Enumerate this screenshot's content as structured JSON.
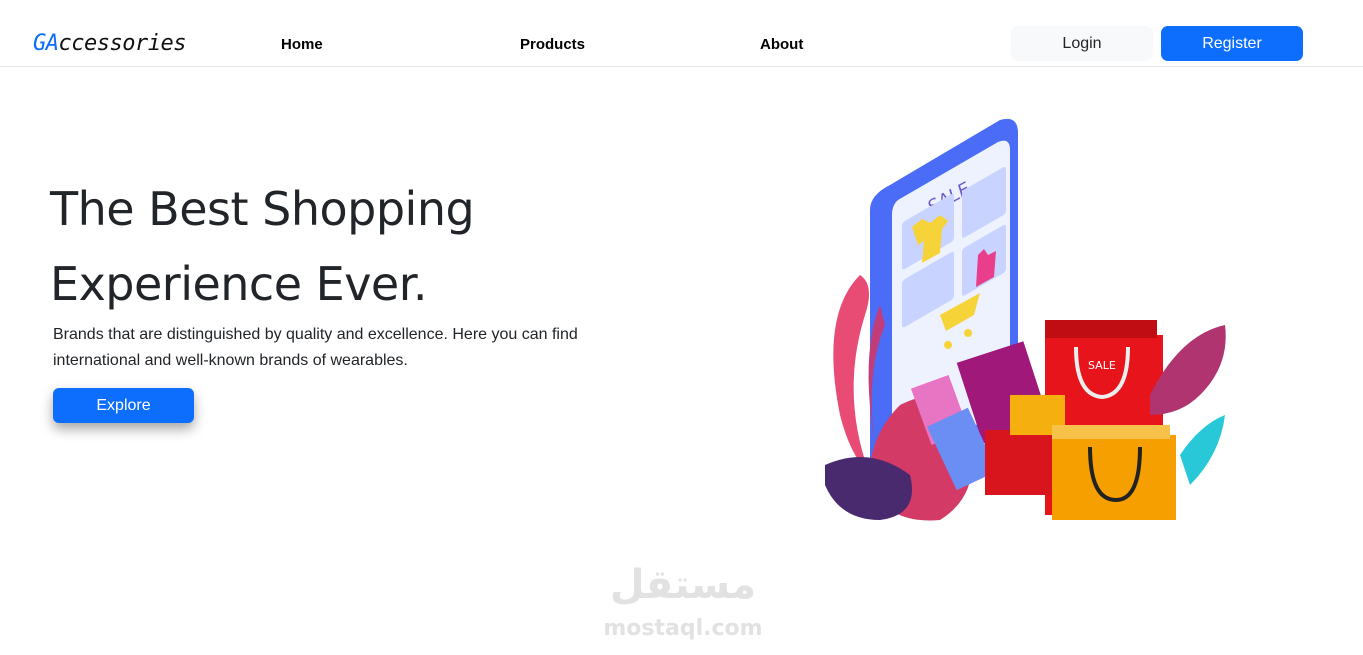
{
  "navbar": {
    "brand_prefix": "GA",
    "brand_suffix": "ccessories",
    "links": [
      "Home",
      "Products",
      "About"
    ],
    "login_label": "Login",
    "register_label": "Register"
  },
  "hero": {
    "title_line1": "The Best Shopping",
    "title_line2": "Experience Ever.",
    "description": "Brands that are distinguished by quality and excellence. Here you can find international and well-known brands of wearables.",
    "explore_label": "Explore"
  },
  "illustration": {
    "sale_label_phone": "SALE",
    "sale_label_bag": "SALE"
  },
  "watermark": {
    "arabic": "مستقل",
    "latin": "mostaql.com"
  },
  "colors": {
    "primary": "#0d6efd",
    "light": "#f8f9fa",
    "text": "#212529"
  }
}
